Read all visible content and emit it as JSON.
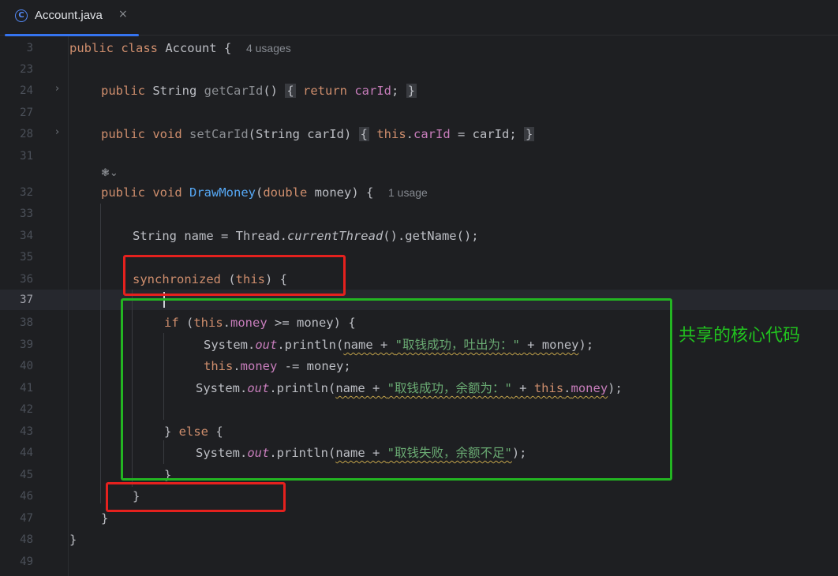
{
  "tab": {
    "icon": "class-c-icon",
    "icon_glyph": "C",
    "label": "Account.java",
    "close": "×"
  },
  "editor": {
    "current_line": "37",
    "hints": {
      "class_usages": "4 usages",
      "method_usages": "1 usage"
    },
    "ai_marker": "❃⌄",
    "lines": [
      {
        "n": "3"
      },
      {
        "n": "23"
      },
      {
        "n": "24"
      },
      {
        "n": "27"
      },
      {
        "n": "28"
      },
      {
        "n": "31"
      },
      {
        "n": "32"
      },
      {
        "n": "33"
      },
      {
        "n": "34"
      },
      {
        "n": "35"
      },
      {
        "n": "36"
      },
      {
        "n": "37"
      },
      {
        "n": "38"
      },
      {
        "n": "39"
      },
      {
        "n": "40"
      },
      {
        "n": "41"
      },
      {
        "n": "42"
      },
      {
        "n": "43"
      },
      {
        "n": "44"
      },
      {
        "n": "45"
      },
      {
        "n": "46"
      },
      {
        "n": "47"
      },
      {
        "n": "48"
      },
      {
        "n": "49"
      }
    ],
    "strings": {
      "s1": "\"取钱成功，吐出为：\"",
      "s2": "\"取钱成功，余额为：\"",
      "s3": "\"取钱失败，余额不足\""
    }
  },
  "annotation": {
    "label": "共享的核心代码",
    "color": "#21c21f"
  },
  "colors": {
    "highlight_red": "#e5211e",
    "highlight_green": "#23b522",
    "accent": "#3574f0"
  }
}
